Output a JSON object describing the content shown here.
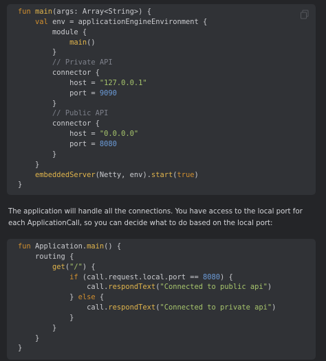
{
  "code_block_1": {
    "copy_icon": "copy-icon",
    "lines": [
      [
        {
          "t": "fun ",
          "c": "kw"
        },
        {
          "t": "main",
          "c": "fn"
        },
        {
          "t": "(args: Array<String>) {",
          "c": "pl"
        }
      ],
      [
        {
          "t": "    ",
          "c": "pl"
        },
        {
          "t": "val",
          "c": "kw"
        },
        {
          "t": " env = applicationEngineEnvironment {",
          "c": "pl"
        }
      ],
      [
        {
          "t": "        module {",
          "c": "pl"
        }
      ],
      [
        {
          "t": "            ",
          "c": "pl"
        },
        {
          "t": "main",
          "c": "fn"
        },
        {
          "t": "()",
          "c": "pl"
        }
      ],
      [
        {
          "t": "        }",
          "c": "pl"
        }
      ],
      [
        {
          "t": "        ",
          "c": "pl"
        },
        {
          "t": "// Private API",
          "c": "cm"
        }
      ],
      [
        {
          "t": "        connector {",
          "c": "pl"
        }
      ],
      [
        {
          "t": "            host = ",
          "c": "pl"
        },
        {
          "t": "\"127.0.0.1\"",
          "c": "str"
        }
      ],
      [
        {
          "t": "            port = ",
          "c": "pl"
        },
        {
          "t": "9090",
          "c": "num"
        }
      ],
      [
        {
          "t": "        }",
          "c": "pl"
        }
      ],
      [
        {
          "t": "        ",
          "c": "pl"
        },
        {
          "t": "// Public API",
          "c": "cm"
        }
      ],
      [
        {
          "t": "        connector {",
          "c": "pl"
        }
      ],
      [
        {
          "t": "            host = ",
          "c": "pl"
        },
        {
          "t": "\"0.0.0.0\"",
          "c": "str"
        }
      ],
      [
        {
          "t": "            port = ",
          "c": "pl"
        },
        {
          "t": "8080",
          "c": "num"
        }
      ],
      [
        {
          "t": "        }",
          "c": "pl"
        }
      ],
      [
        {
          "t": "    }",
          "c": "pl"
        }
      ],
      [
        {
          "t": "    ",
          "c": "pl"
        },
        {
          "t": "embeddedServer",
          "c": "fn"
        },
        {
          "t": "(Netty, env).",
          "c": "pl"
        },
        {
          "t": "start",
          "c": "fn"
        },
        {
          "t": "(",
          "c": "pl"
        },
        {
          "t": "true",
          "c": "kw"
        },
        {
          "t": ")",
          "c": "pl"
        }
      ],
      [
        {
          "t": "}",
          "c": "pl"
        }
      ]
    ]
  },
  "paragraph": "The application will handle all the connections. You have access to the local port for each ApplicationCall, so you can decide what to do based on the local port:",
  "code_block_2": {
    "lines": [
      [
        {
          "t": "fun ",
          "c": "kw"
        },
        {
          "t": "Application.",
          "c": "pl"
        },
        {
          "t": "main",
          "c": "fn"
        },
        {
          "t": "() {",
          "c": "pl"
        }
      ],
      [
        {
          "t": "    routing {",
          "c": "pl"
        }
      ],
      [
        {
          "t": "        ",
          "c": "pl"
        },
        {
          "t": "get",
          "c": "fn"
        },
        {
          "t": "(",
          "c": "pl"
        },
        {
          "t": "\"/\"",
          "c": "str"
        },
        {
          "t": ") {",
          "c": "pl"
        }
      ],
      [
        {
          "t": "            ",
          "c": "pl"
        },
        {
          "t": "if",
          "c": "kw"
        },
        {
          "t": " (call.request.local.port == ",
          "c": "pl"
        },
        {
          "t": "8080",
          "c": "num"
        },
        {
          "t": ") {",
          "c": "pl"
        }
      ],
      [
        {
          "t": "                call.",
          "c": "pl"
        },
        {
          "t": "respondText",
          "c": "fn"
        },
        {
          "t": "(",
          "c": "pl"
        },
        {
          "t": "\"Connected to public api\"",
          "c": "str"
        },
        {
          "t": ")",
          "c": "pl"
        }
      ],
      [
        {
          "t": "            } ",
          "c": "pl"
        },
        {
          "t": "else",
          "c": "kw"
        },
        {
          "t": " {",
          "c": "pl"
        }
      ],
      [
        {
          "t": "                call.",
          "c": "pl"
        },
        {
          "t": "respondText",
          "c": "fn"
        },
        {
          "t": "(",
          "c": "pl"
        },
        {
          "t": "\"Connected to private api\"",
          "c": "str"
        },
        {
          "t": ")",
          "c": "pl"
        }
      ],
      [
        {
          "t": "            }",
          "c": "pl"
        }
      ],
      [
        {
          "t": "        }",
          "c": "pl"
        }
      ],
      [
        {
          "t": "    }",
          "c": "pl"
        }
      ],
      [
        {
          "t": "}",
          "c": "pl"
        }
      ]
    ]
  }
}
